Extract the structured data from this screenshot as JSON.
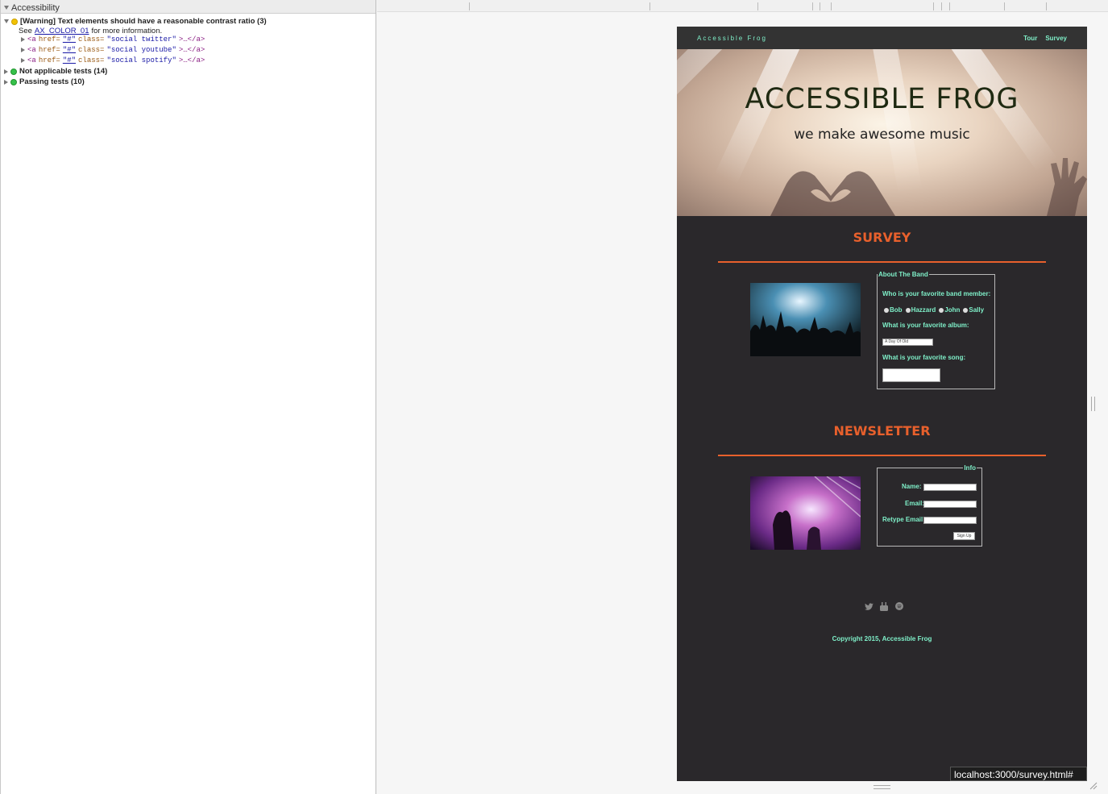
{
  "devtools": {
    "panel_title": "Accessibility",
    "warning": {
      "label": "[Warning] Text elements should have a reasonable contrast ratio (3)",
      "see_prefix": "See",
      "rule_link": "AX_COLOR_01",
      "see_suffix": "for more information.",
      "elements": [
        {
          "open": "<a",
          "href_attr": "href=",
          "href_val": "\"#\"",
          "class_attr": "class=",
          "class_val": "\"social twitter\"",
          "close": ">…</a>"
        },
        {
          "open": "<a",
          "href_attr": "href=",
          "href_val": "\"#\"",
          "class_attr": "class=",
          "class_val": "\"social youtube\"",
          "close": ">…</a>"
        },
        {
          "open": "<a",
          "href_attr": "href=",
          "href_val": "\"#\"",
          "class_attr": "class=",
          "class_val": "\"social spotify\"",
          "close": ">…</a>"
        }
      ]
    },
    "not_applicable": "Not applicable tests (14)",
    "passing": "Passing tests (10)"
  },
  "page": {
    "nav": {
      "brand": "Accessible Frog",
      "links": [
        "Tour",
        "Survey"
      ]
    },
    "hero": {
      "title": "ACCESSIBLE FROG",
      "subtitle": "we make awesome music"
    },
    "survey": {
      "title": "SURVEY",
      "legend": "About The Band",
      "q1": "Who is your favorite band member:",
      "members": [
        "Bob",
        "Hazzard",
        "John",
        "Sally"
      ],
      "q2": "What is your favorite album:",
      "album_value": "A Day Of Old",
      "q3": "What is your favorite song:"
    },
    "newsletter": {
      "title": "NEWSLETTER",
      "legend": "Info",
      "name_label": "Name:",
      "email_label": "Email:",
      "retype_label": "Retype Email:",
      "signup_label": "Sign Up"
    },
    "social_icons": [
      "twitter-icon",
      "youtube-icon",
      "spotify-icon"
    ],
    "copyright": "Copyright 2015, Accessible Frog"
  },
  "status_bar": {
    "url": "localhost:3000/survey.html#"
  },
  "colors": {
    "accent": "#e8602c",
    "mint": "#7ff0c9",
    "page_bg": "#2a282b"
  }
}
